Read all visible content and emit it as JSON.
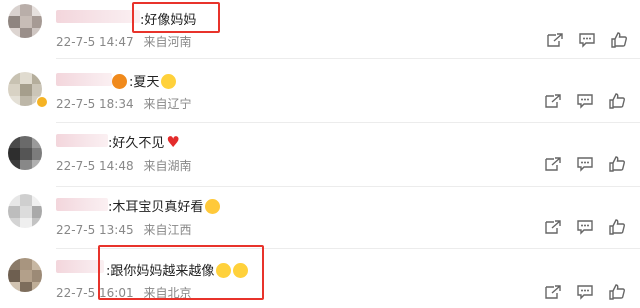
{
  "comments": [
    {
      "text": ":好像妈妈",
      "date": "22-7-5 14:47",
      "location": "来自河南",
      "emojis": []
    },
    {
      "text": ":夏天",
      "date": "22-7-5 18:34",
      "location": "来自辽宁",
      "emojis": [
        "smiling-face"
      ]
    },
    {
      "text": ":好久不见",
      "date": "22-7-5 14:48",
      "location": "来自湖南",
      "emojis": [
        "red-heart"
      ]
    },
    {
      "text": ":木耳宝贝真好看",
      "date": "22-7-5 13:45",
      "location": "来自江西",
      "emojis": [
        "heart-eyes-face"
      ]
    },
    {
      "text": ":跟你妈妈越来越像",
      "date": "22-7-5 16:01",
      "location": "来自北京",
      "emojis": [
        "grinning-face",
        "grinning-face"
      ]
    }
  ],
  "action_icons": [
    "share-icon",
    "comment-icon",
    "like-icon"
  ],
  "colors": {
    "highlight": "#e8332b",
    "meta_text": "#888888",
    "name_blur": "#f3d6dc"
  }
}
